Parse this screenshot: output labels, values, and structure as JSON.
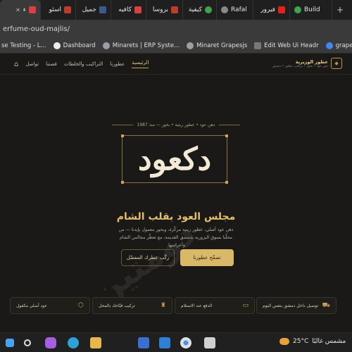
{
  "browser": {
    "tabs": [
      {
        "label": "ء",
        "icon": "red-icon",
        "color": "#d94040",
        "active": true
      },
      {
        "label": "اسئو",
        "icon": "page-icon",
        "color": "#c0392b",
        "active": false
      },
      {
        "label": "جميل",
        "icon": "table-icon",
        "color": "#3a5a8a",
        "active": false
      },
      {
        "label": "كافيه",
        "icon": "rocket-icon",
        "color": "#d94040",
        "active": false
      },
      {
        "label": "بروسا",
        "icon": "store-icon",
        "color": "#c0392b",
        "active": false
      },
      {
        "label": "كيفية",
        "icon": "globe-icon",
        "color": "#3fa34d",
        "active": false
      },
      {
        "label": "Rafal",
        "icon": "user-icon",
        "color": "#888888",
        "active": false
      },
      {
        "label": "فيرور",
        "icon": "youtube-icon",
        "color": "#e62117",
        "active": false
      },
      {
        "label": "Build",
        "icon": "dot-icon",
        "color": "#3fa34d",
        "active": false
      }
    ],
    "new_tab": "+",
    "url": "erfume-oud-majlis/",
    "bookmarks": [
      {
        "label": "se Testing - L...",
        "color": "#555555"
      },
      {
        "label": "Dashboard",
        "color": "#444444"
      },
      {
        "label": "Minarets | ERP Syste...",
        "color": "#555555"
      },
      {
        "label": "Minaret Grapesjs",
        "color": "#555555"
      },
      {
        "label": "Edit Web Ui Headr",
        "color": "#3a3a3a"
      },
      {
        "label": "grapesjs - بحث Goo",
        "color": "#4285f4"
      }
    ]
  },
  "site": {
    "brand_title": "عطور الوزيرية",
    "brand_subtitle": "دهن عود • بخور • تراكيب عطور • دمشق",
    "nav": [
      "الرئيسية",
      "عطورنا",
      "التراكيب والخلطات",
      "قصتنا",
      "تواصل"
    ],
    "home_icon": "home-icon",
    "hero_tagline": "دهن عود • عطور زيتية • بخور — منذ 1987",
    "hero_logotype": "دكعود",
    "hero_title": "مجلس العود بقلب الشام",
    "hero_description": "دهن عود أصلي، عطور زيتية مركّزة، وبخور معمول بإيدنا — من محلّنا بسوق البزورية بدمشق القديمة، مع تعطّر مجالس الشام وأعراسها.",
    "cta_primary": "تصفّح عطورنا",
    "cta_secondary": "ركّب عطرك المفضّل",
    "watermark": "دومتين",
    "features": [
      {
        "label": "توصيل داخل دمشق بنفس اليوم",
        "icon": "truck-icon"
      },
      {
        "label": "الدفع عند الاستلام",
        "icon": "money-icon"
      },
      {
        "label": "تركيب فيّاحك بالمحل",
        "icon": "bottle-icon"
      },
      {
        "label": "عود أصلي مكفول",
        "icon": "badge-icon"
      }
    ]
  },
  "taskbar": {
    "weather_temp": "25°C",
    "weather_text": "مشمس غالبًا",
    "apps": [
      {
        "icon": "windows-icon",
        "color": "#4aa3f0"
      },
      {
        "icon": "search-icon",
        "color": "#e0e0e0"
      },
      {
        "icon": "copilot-icon",
        "color": "#a55fe0"
      },
      {
        "icon": "edge-icon",
        "color": "#2fa0d8"
      },
      {
        "icon": "folder-icon",
        "color": "#e6b84a"
      },
      {
        "icon": "store-icon",
        "color": "#3a6fd0"
      },
      {
        "icon": "vscode-icon",
        "color": "#2f7fd6"
      },
      {
        "icon": "chrome-icon",
        "color": "#e0e0e0"
      },
      {
        "icon": "app-icon",
        "color": "#d0d0d0"
      }
    ]
  }
}
